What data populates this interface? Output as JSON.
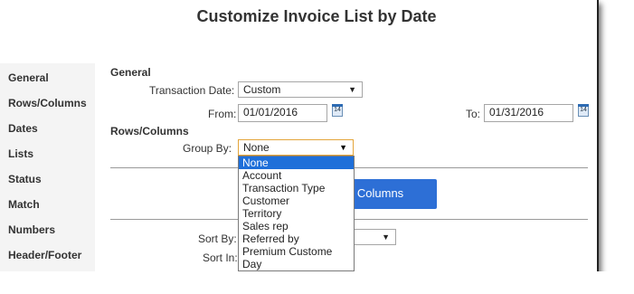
{
  "window": {
    "title": "Customize Invoice List by Date"
  },
  "sidebar": {
    "items": [
      {
        "label": "General"
      },
      {
        "label": "Rows/Columns"
      },
      {
        "label": "Dates"
      },
      {
        "label": "Lists"
      },
      {
        "label": "Status"
      },
      {
        "label": "Match"
      },
      {
        "label": "Numbers"
      },
      {
        "label": "Header/Footer"
      }
    ]
  },
  "general": {
    "heading": "General",
    "transaction_date_label": "Transaction Date:",
    "transaction_date_value": "Custom",
    "from_label": "From:",
    "from_value": "01/01/2016",
    "to_label": "To:",
    "to_value": "01/31/2016",
    "calendar_icon_text": "14"
  },
  "rows_columns": {
    "heading": "Rows/Columns",
    "group_by_label": "Group By:",
    "group_by_value": "None",
    "change_columns_label": "ge Columns",
    "sort_by_label": "Sort By:",
    "sort_in_label": "Sort In:"
  },
  "group_by_dropdown": {
    "options": [
      {
        "label": "None",
        "selected": true
      },
      {
        "label": "Account"
      },
      {
        "label": "Transaction Type"
      },
      {
        "label": "Customer"
      },
      {
        "label": "Territory"
      },
      {
        "label": "Sales rep"
      },
      {
        "label": "Referred by"
      },
      {
        "label": "Premium Custome"
      },
      {
        "label": "Day"
      }
    ]
  },
  "colors": {
    "accent": "#2d6fd6",
    "selected_option": "#1e6fd9",
    "focus_border": "#e4a53a"
  }
}
